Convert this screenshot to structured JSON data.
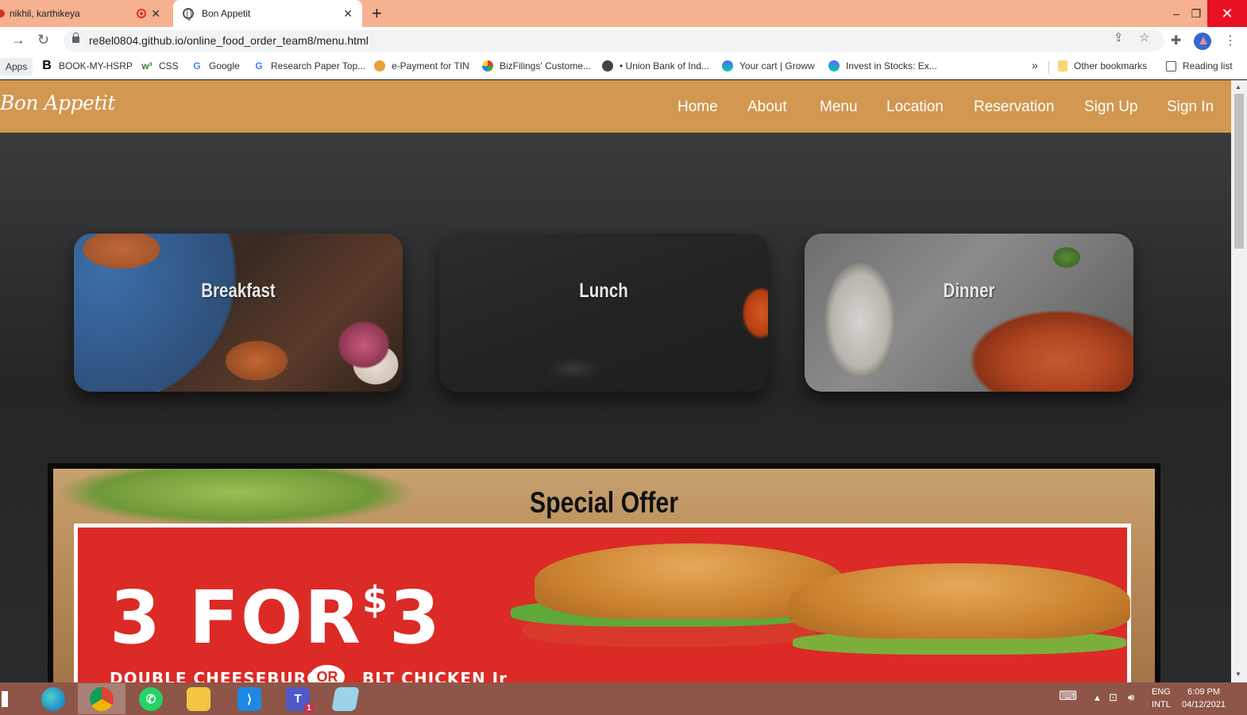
{
  "browser": {
    "tabs": [
      {
        "title": "nikhil, karthikeya",
        "active": false
      },
      {
        "title": "Bon Appetit",
        "active": true
      }
    ],
    "new_tab": "+",
    "url": "re8el0804.github.io/online_food_order_team8/menu.html",
    "bookmarks": [
      {
        "label": "Apps",
        "icon": "apps-grid-icon"
      },
      {
        "label": "BOOK-MY-HSRP",
        "icon": "b-letter-icon"
      },
      {
        "label": "CSS",
        "icon": "w3-icon"
      },
      {
        "label": "Google",
        "icon": "google-icon"
      },
      {
        "label": "Research Paper Top...",
        "icon": "google-icon"
      },
      {
        "label": "e-Payment for TIN",
        "icon": "epay-icon"
      },
      {
        "label": "BizFilings' Custome...",
        "icon": "bizfilings-icon"
      },
      {
        "label": "• Union Bank of Ind...",
        "icon": "globe-icon"
      },
      {
        "label": "Your cart | Groww",
        "icon": "groww-icon"
      },
      {
        "label": "Invest in Stocks: Ex...",
        "icon": "groww-icon"
      }
    ],
    "overflow": "»",
    "other_bookmarks": "Other bookmarks",
    "reading_list": "Reading list"
  },
  "site": {
    "brand": "Bon Appetit",
    "nav": [
      "Home",
      "About",
      "Menu",
      "Location",
      "Reservation",
      "Sign Up",
      "Sign In"
    ],
    "nav_color": "#d29750",
    "cards": [
      {
        "title": "Breakfast"
      },
      {
        "title": "Lunch"
      },
      {
        "title": "Dinner"
      }
    ],
    "offer": {
      "title": "Special Offer",
      "headline_number": "3",
      "headline_for": "FOR",
      "headline_price_symbol": "$",
      "headline_price": "3",
      "sub_left": "DOUBLE CHEESEBURGER",
      "or": "OR",
      "sub_right": "BLT CHICKEN Jr"
    }
  },
  "taskbar": {
    "apps": [
      "edge-icon",
      "chrome-icon",
      "whatsapp-icon",
      "file-explorer-icon",
      "vscode-icon",
      "teams-icon",
      "notepad-icon"
    ],
    "teams_badge": "1",
    "lang": "ENG",
    "layout": "INTL",
    "time": "6:09 PM",
    "date": "04/12/2021"
  }
}
